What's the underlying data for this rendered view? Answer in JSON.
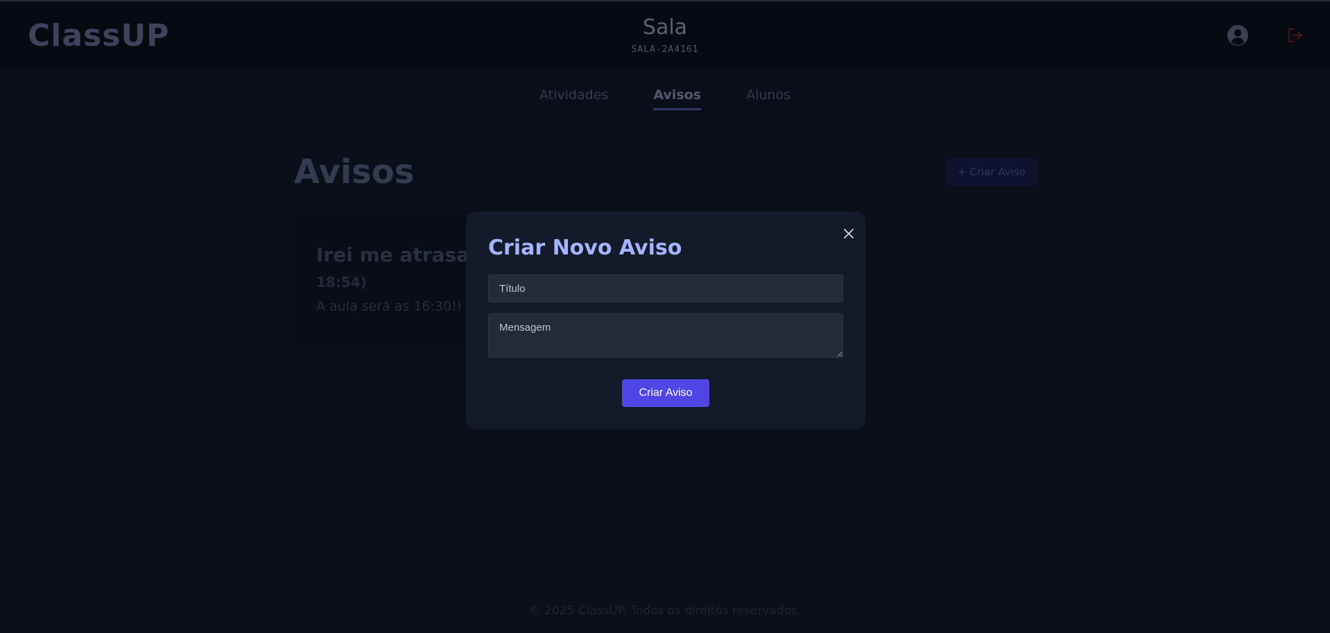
{
  "app": {
    "logo": "ClassUP"
  },
  "header": {
    "title": "Sala",
    "code": "SALA-2A4161"
  },
  "tabs": [
    {
      "label": "Atividades",
      "active": false
    },
    {
      "label": "Avisos",
      "active": true
    },
    {
      "label": "Alunos",
      "active": false
    }
  ],
  "section": {
    "title": "Avisos",
    "create_label": "+ Criar Aviso"
  },
  "notice_card": {
    "title": "Irei me atrasar p",
    "time": "18:54)",
    "message": "A aula será as 16:30!!"
  },
  "modal": {
    "title": "Criar Novo Aviso",
    "title_placeholder": "Título",
    "message_placeholder": "Mensagem",
    "submit_label": "Criar Aviso"
  },
  "footer": {
    "text": "© 2025 ClassUP. Todos os direitos reservados."
  },
  "colors": {
    "accent": "#4f46e5",
    "modal_title": "#a5b4fc",
    "logout": "#7f1d1d"
  },
  "icons": {
    "user": "user-circle-icon",
    "logout": "logout-icon",
    "close": "close-icon"
  }
}
